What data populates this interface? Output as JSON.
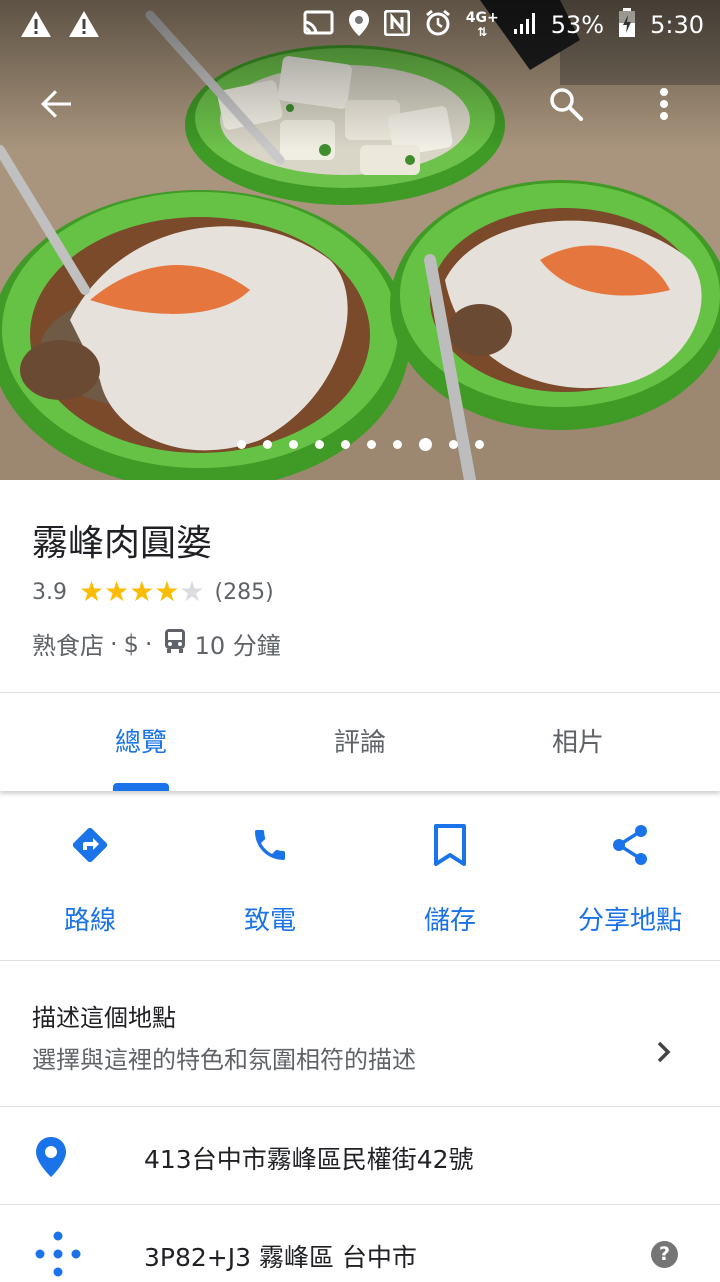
{
  "status_bar": {
    "network": "4G+",
    "battery": "53%",
    "time": "5:30",
    "icons": [
      "warning-icon",
      "warning-icon",
      "cast-icon",
      "location-icon",
      "nfc-icon",
      "alarm-icon",
      "signal-icon",
      "battery-icon"
    ]
  },
  "app_bar": {
    "icons": [
      "back-arrow-icon",
      "search-icon",
      "more-vert-icon"
    ]
  },
  "photo": {
    "description_icon": "photo",
    "dot_count": 10,
    "active_dot": 7
  },
  "place": {
    "name": "霧峰肉圓婆",
    "rating": "3.9",
    "rating_value": 3.9,
    "review_count": "(285)",
    "category": "熟食店",
    "price": "$",
    "transit_time": "10 分鐘",
    "separator": "·"
  },
  "tabs": [
    {
      "label": "總覽",
      "active": true
    },
    {
      "label": "評論",
      "active": false
    },
    {
      "label": "相片",
      "active": false
    }
  ],
  "actions": [
    {
      "label": "路線",
      "icon": "directions-icon"
    },
    {
      "label": "致電",
      "icon": "phone-icon"
    },
    {
      "label": "儲存",
      "icon": "bookmark-icon"
    },
    {
      "label": "分享地點",
      "icon": "share-icon"
    }
  ],
  "describe": {
    "title": "描述這個地點",
    "subtitle": "選擇與這裡的特色和氛圍相符的描述"
  },
  "address": "413台中市霧峰區民權街42號",
  "plus_code": "3P82+J3 霧峰區 台中市",
  "help_symbol": "?",
  "colors": {
    "accent": "#1a73e8",
    "star": "#fbbc04",
    "star_empty": "#dadce0",
    "bowl": "#4caf2e"
  }
}
